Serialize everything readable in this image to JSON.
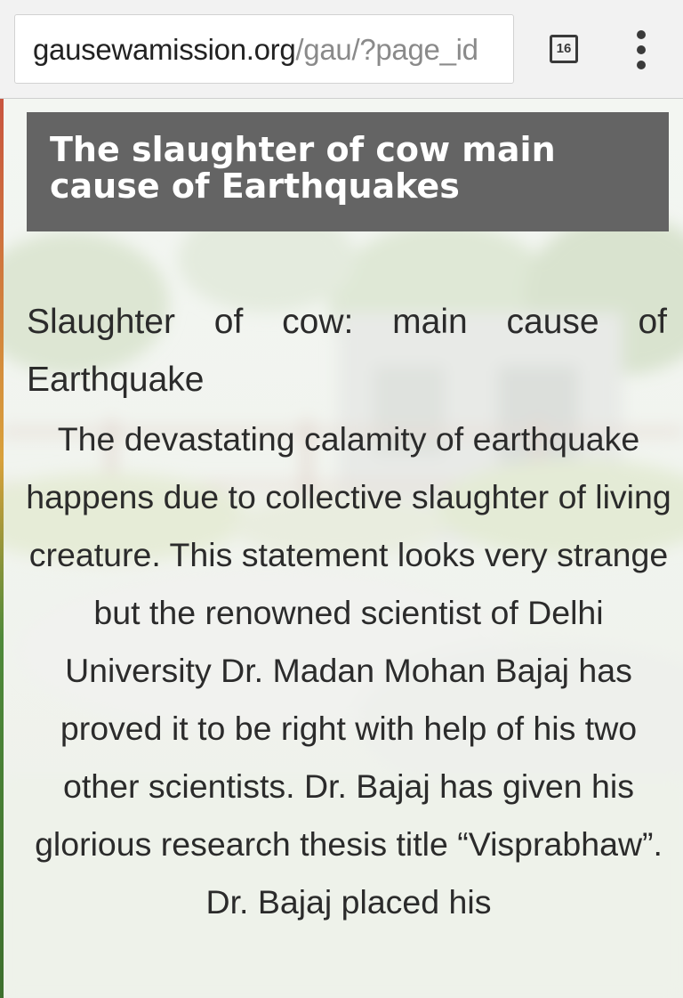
{
  "browser": {
    "url_host": "gausewamission.org",
    "url_path": "/gau/?page_id",
    "tab_count": "16",
    "tabs_icon": "tab-switcher-icon",
    "menu_icon": "overflow-menu-icon"
  },
  "article": {
    "title": "The slaughter of cow main cause of Earthquakes",
    "subheading": "Slaughter of cow: main cause of Earthquake",
    "body": "The devastating calamity of earthquake happens due to collective slaughter of living creature. This statement looks very strange but the renowned scientist of Delhi University Dr. Madan Mohan Bajaj has proved it to be right with help of his two other scientists. Dr. Bajaj has given his glorious research thesis title “Visprabhaw”. Dr. Bajaj placed his"
  },
  "colors": {
    "title_bg": "#646464",
    "title_text": "#ffffff",
    "body_text": "#2b2b2b"
  }
}
